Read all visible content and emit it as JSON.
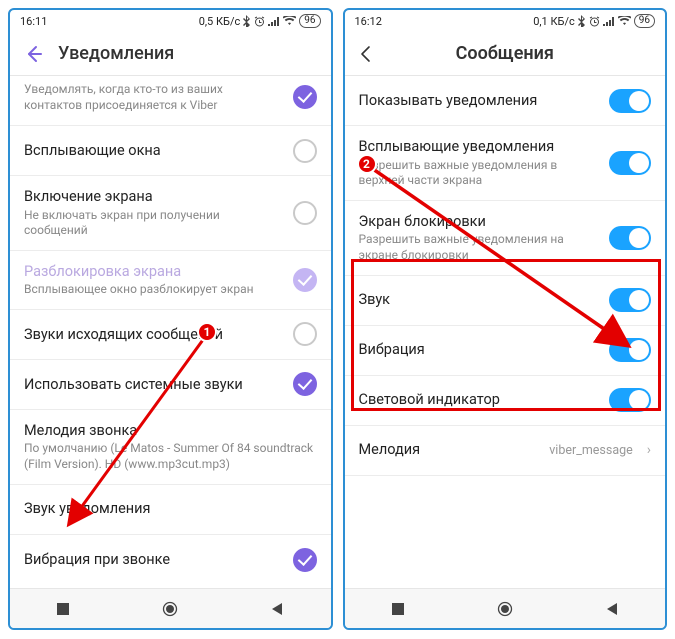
{
  "left": {
    "statusbar": {
      "time": "16:11",
      "net": "0,5 КБ/с",
      "battery": "96"
    },
    "header": {
      "title": "Уведомления"
    },
    "rows": {
      "addcontact_sub": "Уведомлять, когда кто-то из ваших контактов присоединяется к Viber",
      "popups_label": "Всплывающие окна",
      "screen_label": "Включение экрана",
      "screen_sub": "Не включать экран при получении сообщений",
      "unlock_label": "Разблокировка экрана",
      "unlock_sub": "Всплывающее окно разблокирует экран",
      "outgoing_label": "Звуки исходящих сообщений",
      "systemsounds_label": "Использовать системные звуки",
      "ringtone_label": "Мелодия звонка",
      "ringtone_sub": "По умолчанию (Le Matos - Summer Of 84 soundtrack (Film Version). HD (www.mp3cut.mp3)",
      "notifsound_label": "Звук уведомления",
      "vibrate_label": "Вибрация при звонке"
    }
  },
  "right": {
    "statusbar": {
      "time": "16:12",
      "net": "0,1 КБ/с",
      "battery": "96"
    },
    "header": {
      "title": "Сообщения"
    },
    "rows": {
      "show_label": "Показывать уведомления",
      "popup_label": "Всплывающие уведомления",
      "popup_sub": "Разрешить важные уведомления в верхней части экрана",
      "lockscreen_label": "Экран блокировки",
      "lockscreen_sub": "Разрешить важные уведомления на экране блокировки",
      "sound_label": "Звук",
      "vib_label": "Вибрация",
      "light_label": "Световой индикатор",
      "ringtone_label": "Мелодия",
      "ringtone_value": "viber_message"
    }
  }
}
